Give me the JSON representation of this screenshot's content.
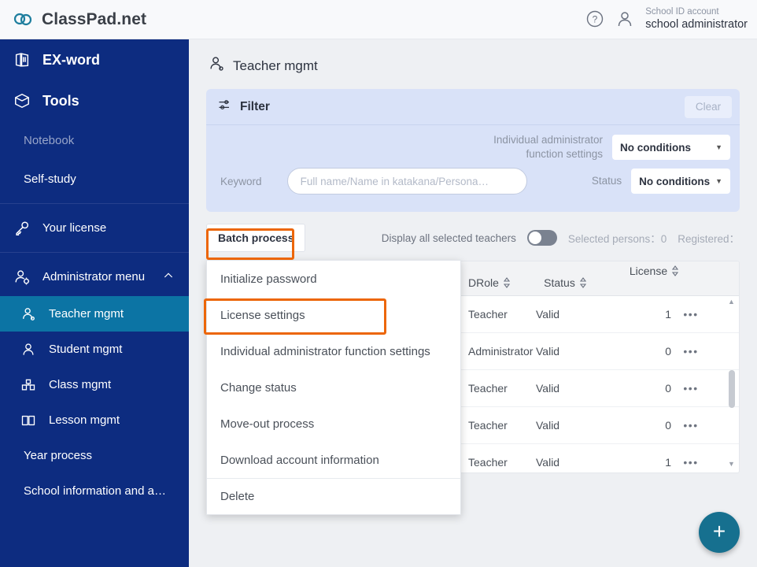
{
  "header": {
    "brand": "ClassPad.net",
    "help_icon": "question-circle-icon",
    "account_icon": "person-icon",
    "account_label": "School ID account",
    "account_name": "school administrator"
  },
  "sidebar": {
    "items": [
      {
        "label": "EX-word",
        "icon": "book-icon",
        "style": "big"
      },
      {
        "label": "Tools",
        "icon": "box-icon",
        "style": "big"
      },
      {
        "label": "Notebook",
        "icon": "none",
        "style": "dim"
      },
      {
        "label": "Self-study",
        "icon": "none",
        "style": "plain"
      },
      {
        "label": "Your license",
        "icon": "key-icon",
        "style": "normal"
      },
      {
        "label": "Administrator menu",
        "icon": "person-gear-icon",
        "style": "normal",
        "chevron": "chevron-up-icon"
      }
    ],
    "submenu": [
      {
        "label": "Teacher mgmt",
        "icon": "teacher-icon",
        "active": true
      },
      {
        "label": "Student mgmt",
        "icon": "student-icon",
        "active": false
      },
      {
        "label": "Class mgmt",
        "icon": "class-icon",
        "active": false
      },
      {
        "label": "Lesson mgmt",
        "icon": "book-open-icon",
        "active": false
      },
      {
        "label": "Year process",
        "icon": "none",
        "active": false
      },
      {
        "label": "School information and a…",
        "icon": "none",
        "active": false
      }
    ]
  },
  "page": {
    "title": "Teacher mgmt",
    "title_icon": "teacher-icon"
  },
  "filter": {
    "title": "Filter",
    "icon": "sliders-icon",
    "clear_label": "Clear",
    "admin_fn_label": "Individual administrator function settings",
    "admin_fn_value": "No conditions",
    "keyword_label": "Keyword",
    "keyword_value": "",
    "keyword_placeholder": "Full name/Name in katakana/Persona…",
    "status_label": "Status",
    "status_value": "No conditions"
  },
  "toolbar": {
    "batch_label": "Batch process",
    "toggle_label": "Display all selected teachers",
    "toggle_on": false,
    "selected_persons": "Selected persons：0",
    "registered": "Registered："
  },
  "menu": {
    "items": [
      {
        "label": "Initialize password",
        "highlighted": false,
        "sep_above": false
      },
      {
        "label": "License settings",
        "highlighted": true,
        "sep_above": false
      },
      {
        "label": "Individual administrator function settings",
        "highlighted": false,
        "sep_above": false
      },
      {
        "label": "Change status",
        "highlighted": false,
        "sep_above": false
      },
      {
        "label": "Move-out process",
        "highlighted": false,
        "sep_above": false
      },
      {
        "label": "Download account information",
        "highlighted": false,
        "sep_above": false
      },
      {
        "label": "Delete",
        "highlighted": false,
        "sep_above": true
      }
    ]
  },
  "table": {
    "columns": [
      {
        "label": "D",
        "sortable": false
      },
      {
        "label": "Role",
        "sortable": true
      },
      {
        "label": "Status",
        "sortable": true
      },
      {
        "label": "License",
        "sortable": true
      }
    ],
    "rows": [
      {
        "role": "Teacher",
        "status": "Valid",
        "license": "1",
        "menu": "•••"
      },
      {
        "role": "Administrator",
        "status": "Valid",
        "license": "0",
        "menu": "•••"
      },
      {
        "role": "Teacher",
        "status": "Valid",
        "license": "0",
        "menu": "•••"
      },
      {
        "role": "Teacher",
        "status": "Valid",
        "license": "0",
        "menu": "•••"
      },
      {
        "role": "Teacher",
        "status": "Valid",
        "license": "1",
        "menu": "•••"
      }
    ]
  },
  "fab": {
    "icon": "plus-icon",
    "label": "+"
  },
  "colors": {
    "sidebar_navy": "#0d2c80",
    "sidebar_active": "#0c74a4",
    "accent_teal": "#16708f",
    "highlight_orange": "#ec6608",
    "filter_panel": "#d9e2f8"
  }
}
